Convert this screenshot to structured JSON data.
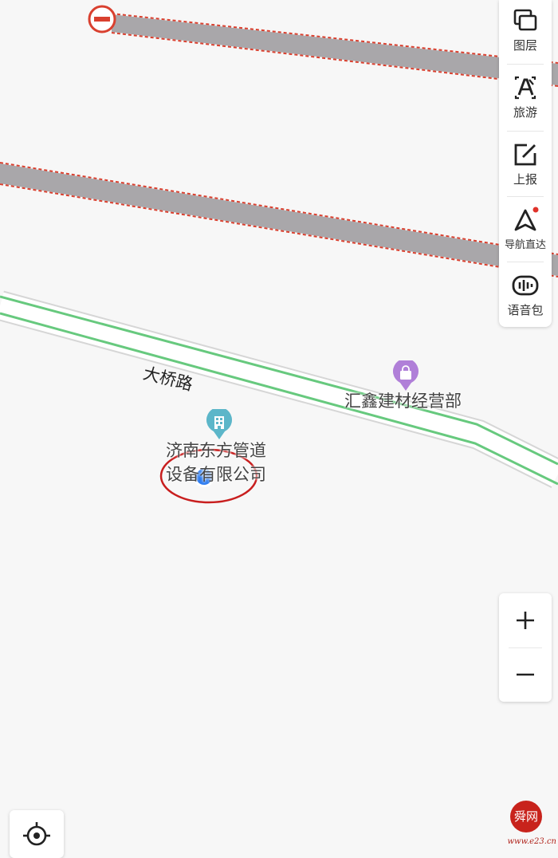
{
  "map": {
    "road_name": "大桥路",
    "pois": [
      {
        "id": "shop",
        "label": "汇鑫建材经营部",
        "pin_color": "#b07fd8"
      },
      {
        "id": "company",
        "label": "济南东方管道设备有限公司",
        "pin_color": "#5cb6c9"
      }
    ],
    "colors": {
      "background": "#f7f7f7",
      "restricted_road_fill": "#a9a7aa",
      "restricted_road_border": "#d9402f",
      "highlight_road": "#67c97e",
      "location_dot": "#2f7df0",
      "annotation_circle": "#c81e1e"
    }
  },
  "toolbar": {
    "items": [
      {
        "label": "图层",
        "icon": "layers-icon"
      },
      {
        "label": "旅游",
        "icon": "tourism-icon"
      },
      {
        "label": "上报",
        "icon": "report-icon"
      },
      {
        "label": "导航直达",
        "icon": "navigation-icon",
        "has_dot": true
      },
      {
        "label": "语音包",
        "icon": "voice-pack-icon"
      }
    ]
  },
  "zoom": {
    "in_label": "+",
    "out_label": "−"
  },
  "locate": {
    "icon": "locate-icon"
  },
  "watermark": {
    "text": "www.e23.cn",
    "seal_text": "舜网"
  }
}
